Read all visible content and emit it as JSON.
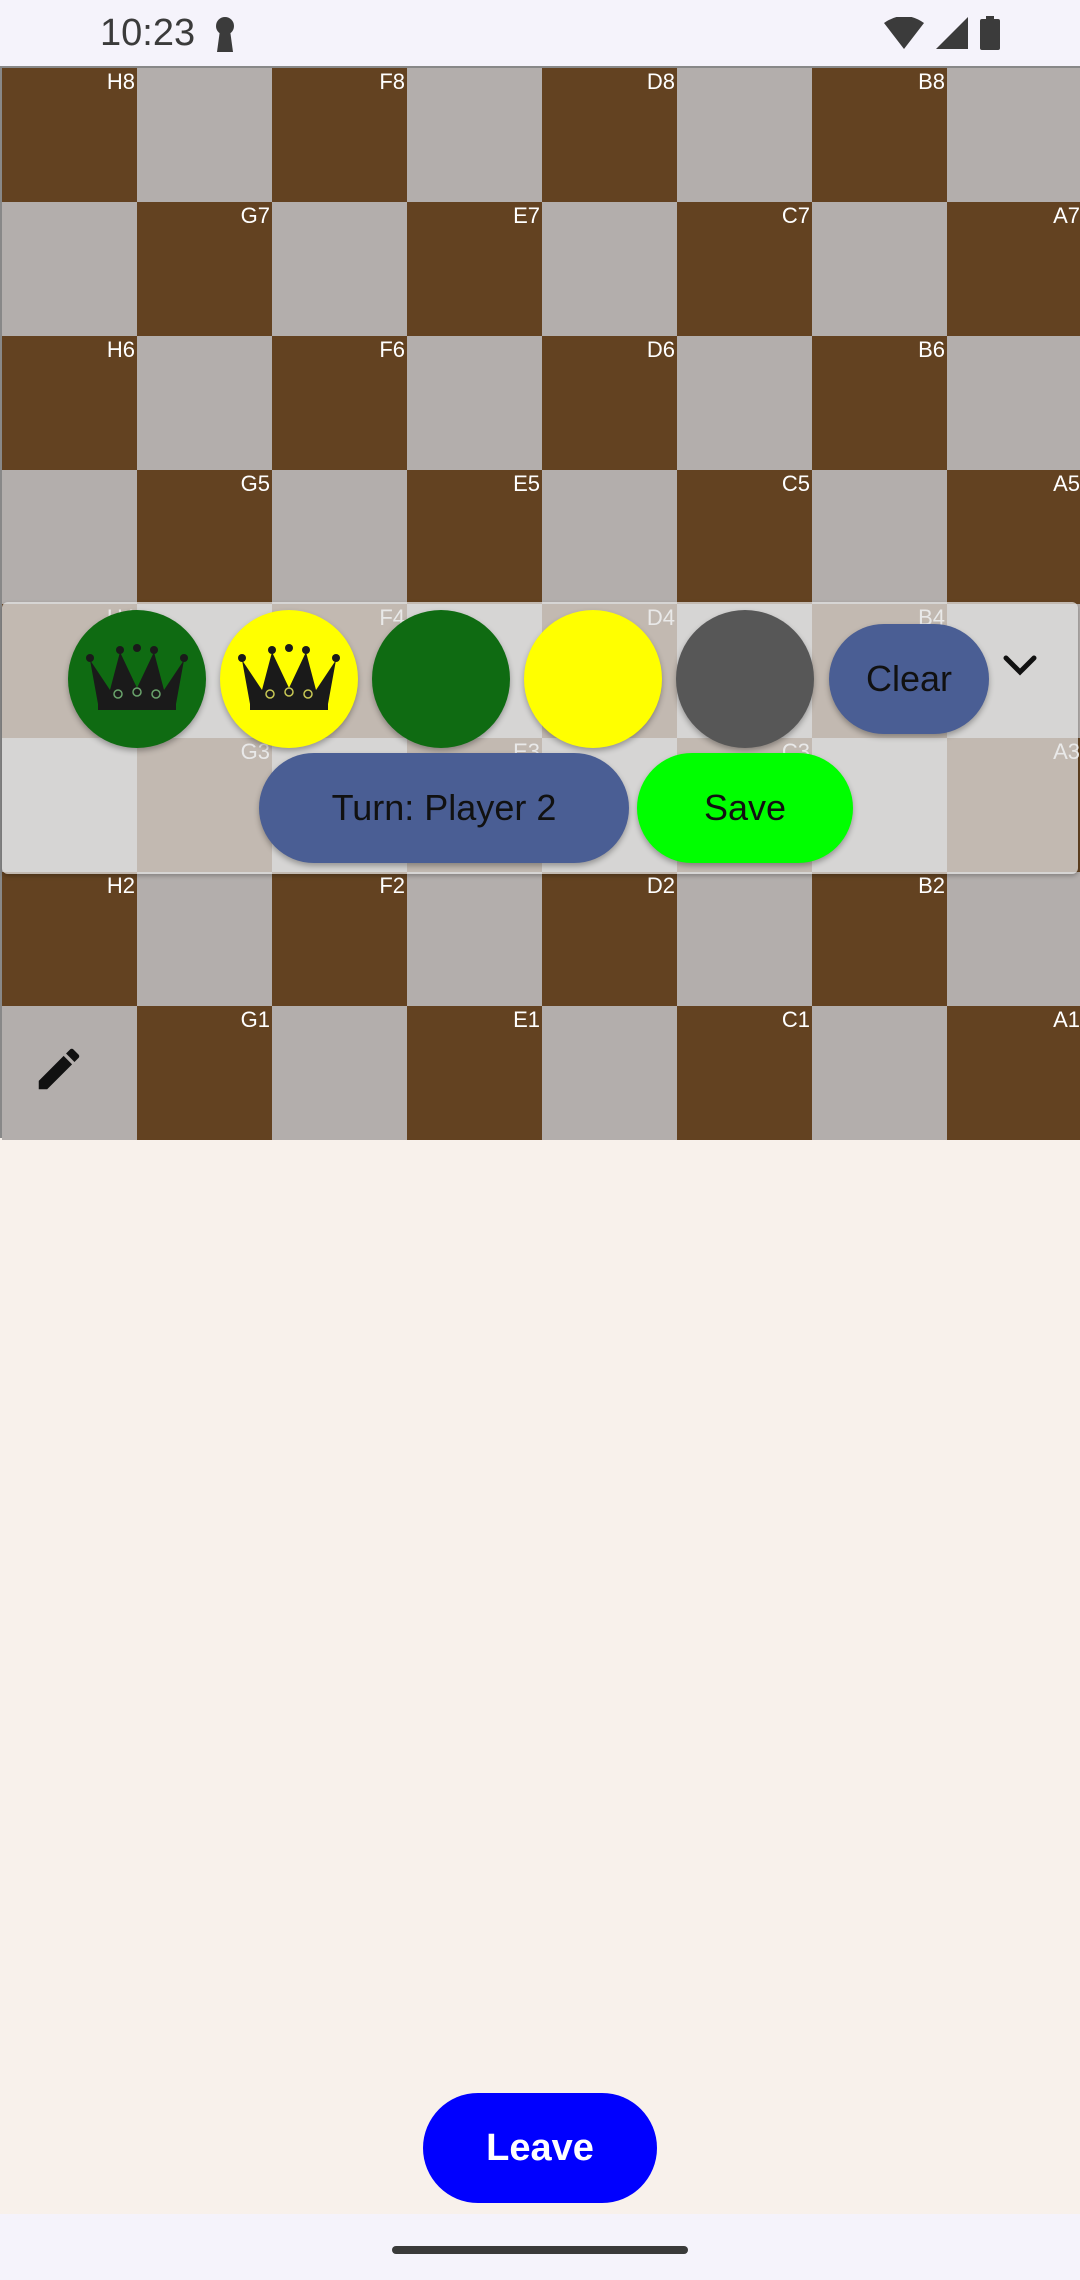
{
  "status_bar": {
    "time": "10:23",
    "icons": [
      "keyhole-icon",
      "wifi-icon",
      "signal-icon",
      "battery-icon"
    ]
  },
  "board": {
    "colors": {
      "dark": "#634221",
      "light": "#b3aeac"
    },
    "coordinates": [
      [
        "H8",
        "F8",
        "D8",
        "B8"
      ],
      [
        "G7",
        "E7",
        "C7",
        "A7"
      ],
      [
        "H6",
        "F6",
        "D6",
        "B6"
      ],
      [
        "G5",
        "E5",
        "C5",
        "A5"
      ],
      [
        "H4",
        "F4",
        "D4",
        "B4"
      ],
      [
        "G3",
        "E3",
        "C3",
        "A3"
      ],
      [
        "H2",
        "F2",
        "D2",
        "B2"
      ],
      [
        "G1",
        "E1",
        "C1",
        "A1"
      ]
    ],
    "edit_icon": "pencil-icon"
  },
  "palette": {
    "pieces": [
      {
        "name": "green-king",
        "color": "#0f6b12",
        "king": true
      },
      {
        "name": "yellow-king",
        "color": "#ffff00",
        "king": true
      },
      {
        "name": "green-man",
        "color": "#0f6b12",
        "king": false
      },
      {
        "name": "yellow-man",
        "color": "#ffff00",
        "king": false
      },
      {
        "name": "empty-eraser",
        "color": "#575757",
        "king": false
      }
    ],
    "clear_label": "Clear",
    "turn_label": "Turn: Player 2",
    "save_label": "Save",
    "collapse_icon": "chevron-down-icon",
    "colors": {
      "clear": "#4a5e94",
      "turn": "#4a5e94",
      "save": "#00ff00"
    }
  },
  "footer": {
    "leave_label": "Leave",
    "leave_color": "#0000ff"
  }
}
